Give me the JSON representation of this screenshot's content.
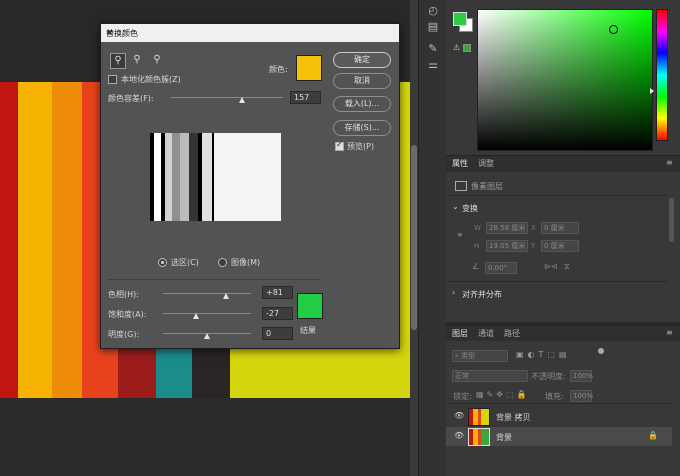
{
  "dialog": {
    "title": "替换颜色",
    "close": "✕",
    "localized_clusters": "本地化颜色簇(Z)",
    "color_label": "颜色:",
    "color_swatch": "#f5c20a",
    "fuzziness_label": "颜色容差(F):",
    "fuzziness_value": "157",
    "fuzziness_level_pct": 63,
    "buttons": {
      "ok": "确定",
      "cancel": "取消",
      "load": "载入(L)...",
      "save": "存储(S)..."
    },
    "preview_label": "预览(P)",
    "preview_checked": true,
    "radio_selection": "选区(C)",
    "radio_image": "图像(M)",
    "hue_label": "色相(H):",
    "hue_value": "+81",
    "hue_level_pct": 72,
    "saturation_label": "饱和度(A):",
    "saturation_value": "-27",
    "saturation_level_pct": 37,
    "lightness_label": "明度(G):",
    "lightness_value": "0",
    "lightness_level_pct": 50,
    "result_label": "结果",
    "result_swatch": "#22cc44"
  },
  "panels": {
    "properties_tab": "属性",
    "adjust_tab": "调整",
    "pixel_layer": "像素图层",
    "transform": "变换",
    "w_label": "W",
    "w_value": "28.58 厘米",
    "x_label": "X",
    "x_value": "0 厘米",
    "h_label": "H",
    "h_value": "19.05 厘米",
    "y_label": "Y",
    "y_value": "0 厘米",
    "angle_value": "0.00°",
    "align_distribute": "对齐并分布",
    "layers_tab": "图层",
    "channels_tab": "通道",
    "paths_tab": "路径",
    "kind_label": "类型",
    "blend_mode": "正常",
    "opacity_label": "不透明度:",
    "opacity_value": "100%",
    "lock_label": "锁定:",
    "fill_label": "填充:",
    "fill_value": "100%",
    "layers": [
      {
        "name": "背景 拷贝"
      },
      {
        "name": "背景"
      }
    ]
  },
  "colors": {
    "foreground": "#2ecc40",
    "background": "#ffffff"
  }
}
